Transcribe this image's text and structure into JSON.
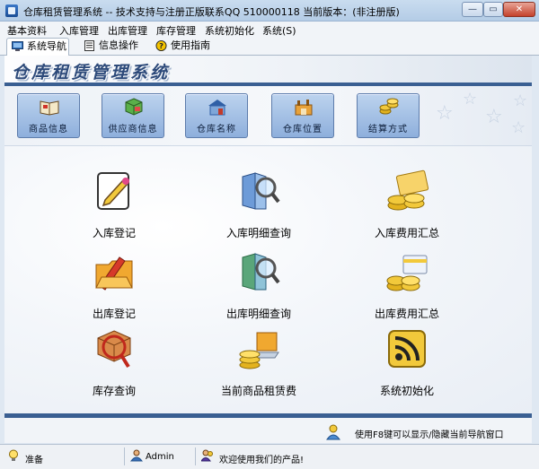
{
  "window": {
    "title": "仓库租赁管理系统 -- 技术支持与注册正版联系QQ 510000118    当前版本：(非注册版)",
    "minimize_glyph": "—",
    "maximize_glyph": "▭",
    "close_glyph": "✕"
  },
  "menu": [
    "基本资料",
    "入库管理",
    "出库管理",
    "库存管理",
    "系统初始化",
    "系统(S)"
  ],
  "tabs": [
    {
      "label": "系统导航",
      "icon": "monitor-icon",
      "active": true
    },
    {
      "label": "信息操作",
      "icon": "document-icon",
      "active": false
    },
    {
      "label": "使用指南",
      "icon": "help-icon",
      "active": false
    }
  ],
  "header": {
    "app_title": "仓库租赁管理系统"
  },
  "toolbar": [
    {
      "label": "商品信息",
      "icon": "book-icon"
    },
    {
      "label": "供应商信息",
      "icon": "cube-icon"
    },
    {
      "label": "仓库名称",
      "icon": "warehouse-icon"
    },
    {
      "label": "仓库位置",
      "icon": "factory-icon"
    },
    {
      "label": "结算方式",
      "icon": "coins-icon"
    }
  ],
  "nav": [
    {
      "label": "入库登记",
      "icon": "pen-paper-icon"
    },
    {
      "label": "入库明细查询",
      "icon": "magnifier-book-icon"
    },
    {
      "label": "入库费用汇总",
      "icon": "coins-card-icon"
    },
    {
      "label": "出库登记",
      "icon": "folder-pen-icon"
    },
    {
      "label": "出库明细查询",
      "icon": "magnifier-book-icon"
    },
    {
      "label": "出库费用汇总",
      "icon": "coins-card-icon"
    },
    {
      "label": "库存查询",
      "icon": "box-search-icon"
    },
    {
      "label": "当前商品租赁费",
      "icon": "coins-laptop-icon"
    },
    {
      "label": "系统初始化",
      "icon": "rss-icon"
    }
  ],
  "hint": {
    "text": "使用F8键可以显示/隐藏当前导航窗口",
    "icon": "user-hint-icon"
  },
  "status": {
    "state": "准备",
    "user": "Admin",
    "message": "欢迎使用我们的产品!"
  },
  "colors": {
    "accent": "#3a5f92",
    "button": "#9fbbe2"
  }
}
